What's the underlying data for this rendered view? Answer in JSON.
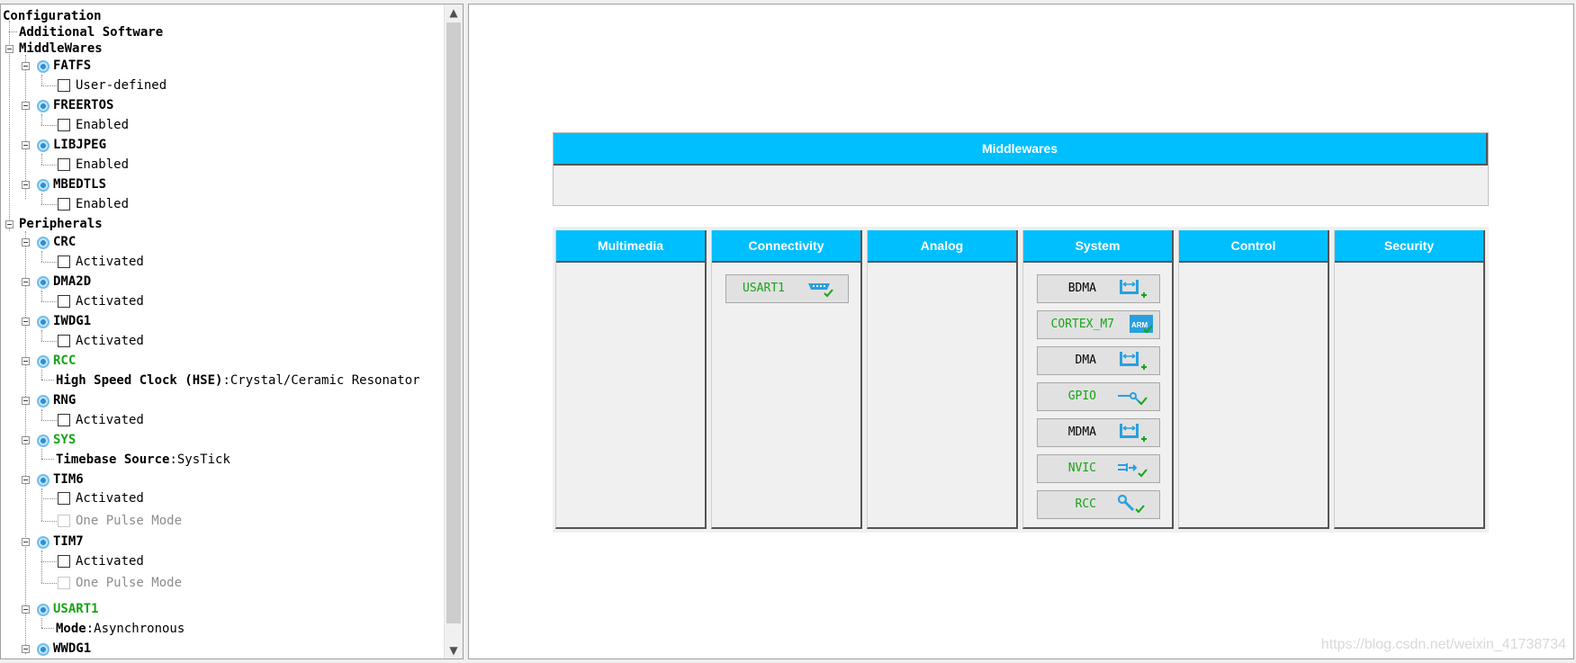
{
  "tree": {
    "root": "Configuration",
    "additional_software": "Additional Software",
    "middlewares": "MiddleWares",
    "fatfs": {
      "name": "FATFS",
      "option": "User-defined"
    },
    "freertos": {
      "name": "FREERTOS",
      "option": "Enabled"
    },
    "libjpeg": {
      "name": "LIBJPEG",
      "option": "Enabled"
    },
    "mbedtls": {
      "name": "MBEDTLS",
      "option": "Enabled"
    },
    "peripherals": "Peripherals",
    "crc": {
      "name": "CRC",
      "option": "Activated"
    },
    "dma2d": {
      "name": "DMA2D",
      "option": "Activated"
    },
    "iwdg1": {
      "name": "IWDG1",
      "option": "Activated"
    },
    "rcc": {
      "name": "RCC",
      "param_label": "High Speed Clock (HSE)",
      "param_value": ":Crystal/Ceramic Resonator"
    },
    "rng": {
      "name": "RNG",
      "option": "Activated"
    },
    "sys": {
      "name": "SYS",
      "param_label": "Timebase Source",
      "param_value": ":SysTick"
    },
    "tim6": {
      "name": "TIM6",
      "option1": "Activated",
      "option2": "One Pulse Mode"
    },
    "tim7": {
      "name": "TIM7",
      "option1": "Activated",
      "option2": "One Pulse Mode"
    },
    "usart1": {
      "name": "USART1",
      "param_label": "Mode",
      "param_value": ":Asynchronous"
    },
    "wwdg1": {
      "name": "WWDG1"
    }
  },
  "scrollbar": {
    "up_arrow": "▲",
    "down_arrow": "▼"
  },
  "panel": {
    "middlewares_header": "Middlewares",
    "categories": [
      "Multimedia",
      "Connectivity",
      "Analog",
      "System",
      "Control",
      "Security"
    ]
  },
  "connectivity_items": [
    "USART1"
  ],
  "system_items": [
    "BDMA",
    "CORTEX_M7",
    "DMA",
    "GPIO",
    "MDMA",
    "NVIC",
    "RCC"
  ],
  "colors": {
    "header_blue": "#00bfff",
    "active_green": "#18a418",
    "icon_blue": "#2a9fe0"
  },
  "watermark": "https://blog.csdn.net/weixin_41738734"
}
